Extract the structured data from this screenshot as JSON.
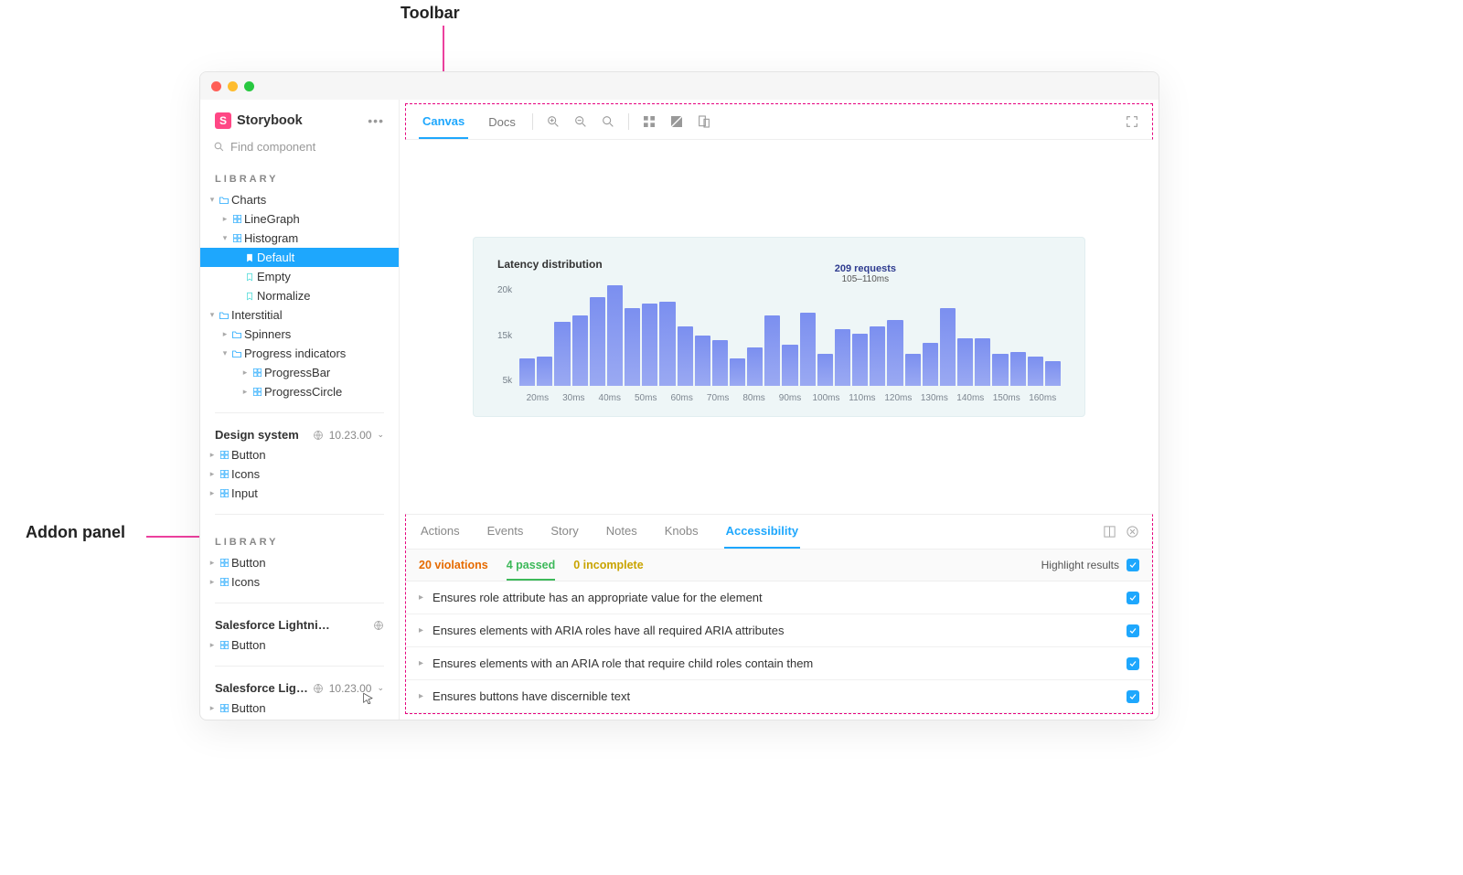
{
  "annotations": {
    "toolbar_label": "Toolbar",
    "addon_label": "Addon panel"
  },
  "app": {
    "brand": "Storybook",
    "search_placeholder": "Find component"
  },
  "sidebar": {
    "library_label": "LIBRARY",
    "charts": {
      "label": "Charts",
      "line_graph": "LineGraph",
      "histogram": {
        "label": "Histogram",
        "stories": {
          "default": "Default",
          "empty": "Empty",
          "normalize": "Normalize"
        }
      }
    },
    "interstitial": {
      "label": "Interstitial",
      "spinners": "Spinners",
      "progress_indicators": {
        "label": "Progress indicators",
        "bar": "ProgressBar",
        "circle": "ProgressCircle"
      }
    },
    "groups": {
      "design_system": {
        "name": "Design system",
        "version": "10.23.00",
        "items": [
          "Button",
          "Icons",
          "Input"
        ]
      },
      "library2_label": "LIBRARY",
      "library2_items": [
        "Button",
        "Icons"
      ],
      "slds": {
        "name": "Salesforce Lightning Design S…",
        "items": [
          "Button"
        ]
      },
      "sl2": {
        "name": "Salesforce Lightni…",
        "version": "10.23.00",
        "items": [
          "Button"
        ]
      }
    }
  },
  "toolbar": {
    "tabs": {
      "canvas": "Canvas",
      "docs": "Docs"
    }
  },
  "chart_data": {
    "type": "bar",
    "title": "Latency distribution",
    "callout": {
      "count_label": "209 requests",
      "range_label": "105–110ms"
    },
    "y_ticks": [
      "20k",
      "15k",
      "5k"
    ],
    "ylim": [
      0,
      22000
    ],
    "x_bins_ms_start": 15,
    "x_bins_ms_step": 5,
    "values": [
      6000,
      6500,
      14000,
      15500,
      19500,
      22000,
      17000,
      18000,
      18500,
      13000,
      11000,
      10000,
      6000,
      8500,
      15500,
      9000,
      16000,
      7000,
      12500,
      11500,
      13000,
      14500,
      7000,
      9500,
      17000,
      10500,
      10500,
      7000,
      7500,
      6500,
      5500
    ],
    "x_ticks": [
      "20ms",
      "30ms",
      "40ms",
      "50ms",
      "60ms",
      "70ms",
      "80ms",
      "90ms",
      "100ms",
      "110ms",
      "120ms",
      "130ms",
      "140ms",
      "150ms",
      "160ms"
    ]
  },
  "addon": {
    "tabs": [
      "Actions",
      "Events",
      "Story",
      "Notes",
      "Knobs",
      "Accessibility"
    ],
    "active_tab": "Accessibility",
    "summary": {
      "violations": "20 violations",
      "passed": "4 passed",
      "incomplete": "0 incomplete",
      "highlight_label": "Highlight results"
    },
    "rows": [
      "Ensures role attribute has an appropriate value for the element",
      "Ensures elements with ARIA roles have all required ARIA attributes",
      "Ensures elements with an ARIA role that require child roles contain them",
      "Ensures buttons have discernible text"
    ]
  }
}
